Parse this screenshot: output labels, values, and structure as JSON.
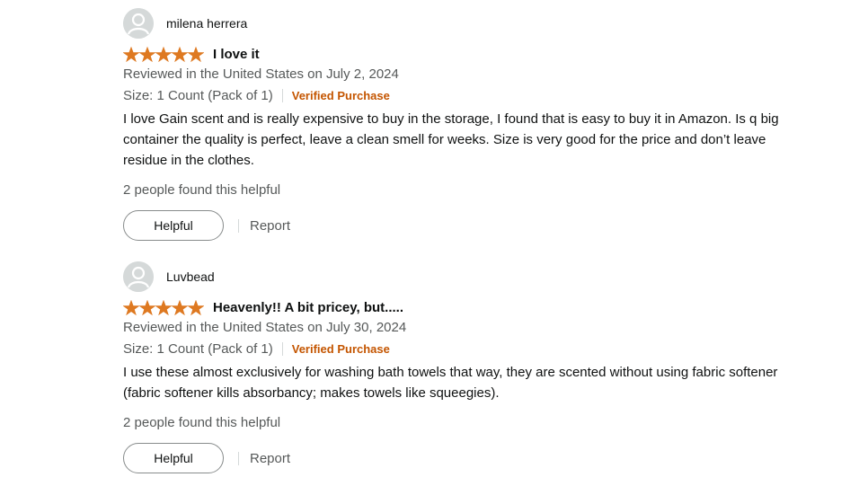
{
  "reviews": [
    {
      "profile_name": "milena herrera",
      "rating": 5,
      "title": "I love it",
      "reviewed_on": "Reviewed in the United States on July 2, 2024",
      "size": "Size: 1 Count (Pack of 1)",
      "verified": "Verified Purchase",
      "body": "I love Gain scent and is really expensive to buy in the storage, I found that is easy to buy it in Amazon. Is q big container the quality is perfect, leave a clean smell for weeks. Size is very good for the price and don’t leave residue in the clothes.",
      "helpful_count": "2 people found this helpful",
      "helpful_label": "Helpful",
      "report_label": "Report"
    },
    {
      "profile_name": "Luvbead",
      "rating": 5,
      "title": "Heavenly!! A bit pricey, but.....",
      "reviewed_on": "Reviewed in the United States on July 30, 2024",
      "size": "Size: 1 Count (Pack of 1)",
      "verified": "Verified Purchase",
      "body": "I use these almost exclusively for washing bath towels that way, they are scented without using fabric softener (fabric softener kills absorbancy; makes towels like squeegies).",
      "helpful_count": "2 people found this helpful",
      "helpful_label": "Helpful",
      "report_label": "Report"
    }
  ],
  "colors": {
    "star": "#de7921",
    "verified": "#c45500",
    "secondary_text": "#565959",
    "avatar_bg": "#d5d9d9"
  },
  "icons": {
    "avatar": "user-avatar-icon",
    "star": "star-icon"
  }
}
